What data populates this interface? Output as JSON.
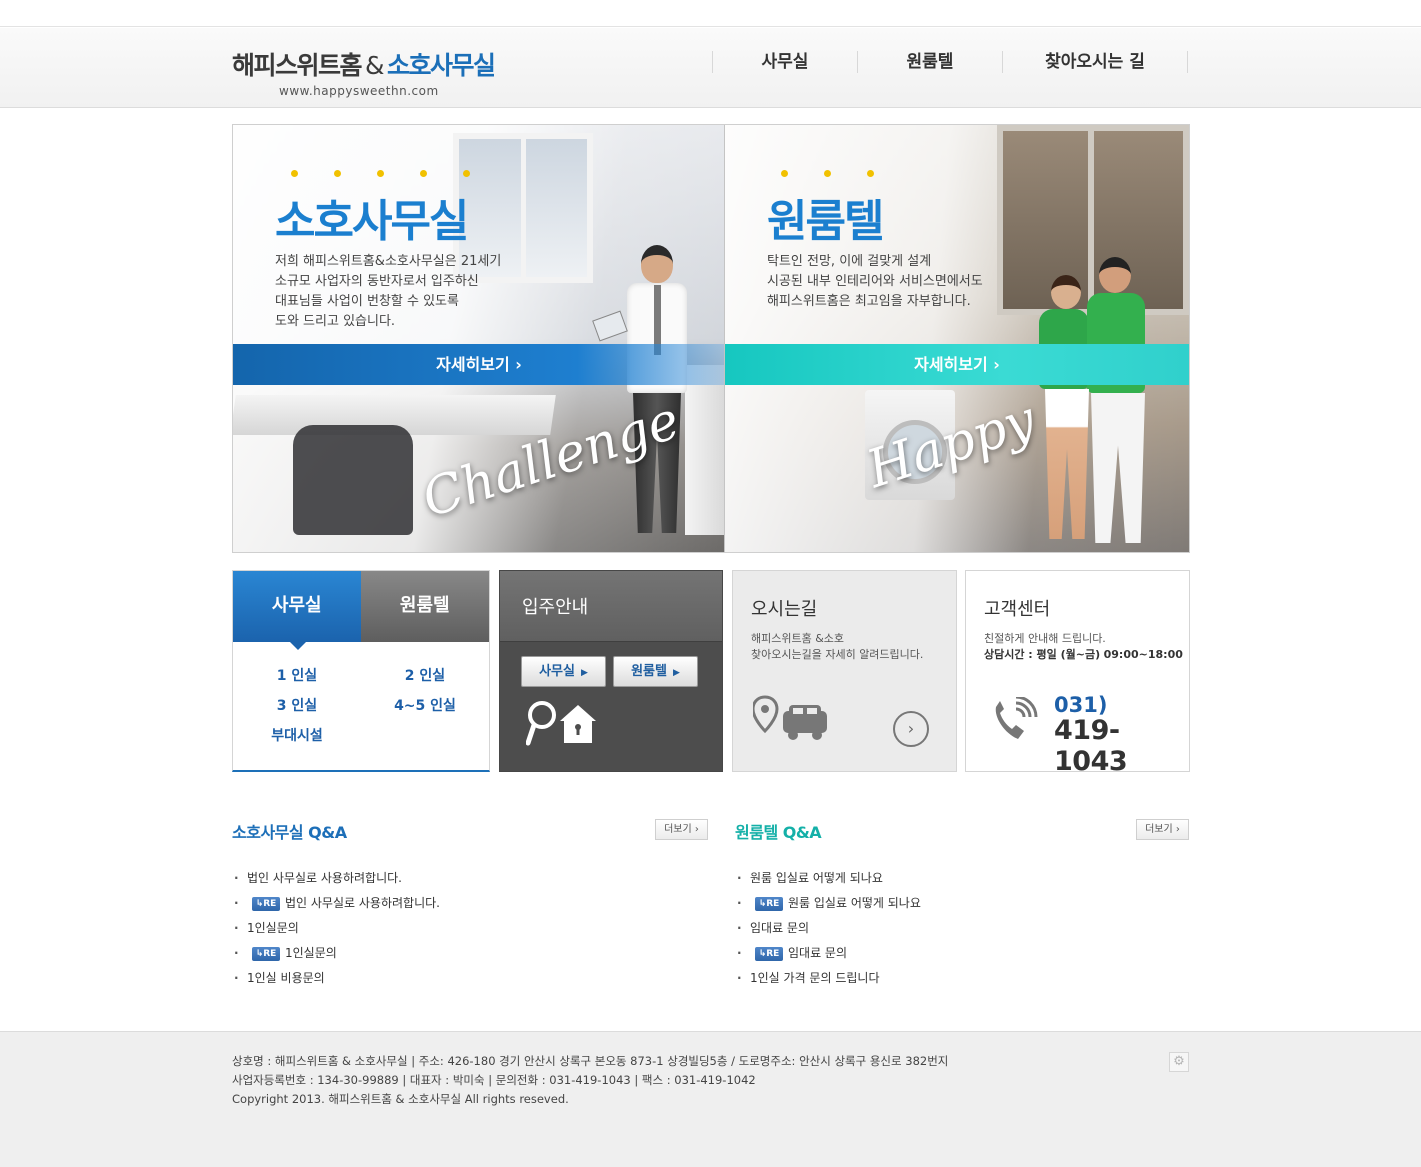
{
  "header": {
    "logo_main": "해피스위트홈",
    "logo_amp": "&",
    "logo_soho": "소호사무실",
    "logo_url": "www.happysweethn.com",
    "nav": [
      "사무실",
      "원룸텔",
      "찾아오시는 길"
    ]
  },
  "hero": {
    "left": {
      "title": "소호사무실",
      "desc": [
        "저희 해피스위트홈&소호사무실은 21세기",
        "소규모 사업자의 동반자로서 입주하신",
        "대표님들 사업이 번창할 수 있도록",
        "도와 드리고 있습니다."
      ],
      "button": "자세히보기",
      "script": "Challenge"
    },
    "right": {
      "title": "원룸텔",
      "desc": [
        "탁트인 전망, 이에 걸맞게 설계",
        "시공된 내부 인테리어와 서비스면에서도",
        "해피스위트홈은 최고임을 자부합니다."
      ],
      "button": "자세히보기",
      "script": "Happy"
    }
  },
  "rooms_widget": {
    "tabs": [
      "사무실",
      "원룸텔"
    ],
    "items": [
      "1 인실",
      "2 인실",
      "3 인실",
      "4~5 인실",
      "부대시설"
    ]
  },
  "move_in": {
    "title": "입주안내",
    "buttons": [
      "사무실",
      "원룸텔"
    ],
    "icon": "search-house-icon"
  },
  "directions": {
    "title": "오시는길",
    "sub": [
      "해피스위트홈 &소호",
      "찾아오시는길을 자세히 알려드립니다."
    ],
    "icon": "location-car-icon"
  },
  "customer_center": {
    "title": "고객센터",
    "sub": "친절하게 안내해 드립니다.",
    "hours_label": "상담시간 : 평일 (월~금)",
    "hours_value": "09:00~18:00",
    "phone_area": "031)",
    "phone_number": "419-1043"
  },
  "qna_office": {
    "title": "소호사무실 Q&A",
    "more": "더보기",
    "items": [
      {
        "reply": false,
        "text": "법인 사무실로 사용하려합니다."
      },
      {
        "reply": true,
        "text": "법인 사무실로 사용하려합니다."
      },
      {
        "reply": false,
        "text": "1인실문의"
      },
      {
        "reply": true,
        "text": "1인실문의"
      },
      {
        "reply": false,
        "text": "1인실 비용문의"
      }
    ]
  },
  "qna_room": {
    "title": "원룸텔 Q&A",
    "more": "더보기",
    "items": [
      {
        "reply": false,
        "text": "원룸 입실료 어떻게 되나요"
      },
      {
        "reply": true,
        "text": "원룸 입실료 어떻게 되나요"
      },
      {
        "reply": false,
        "text": "임대료 문의"
      },
      {
        "reply": true,
        "text": "임대료 문의"
      },
      {
        "reply": false,
        "text": "1인실 가격 문의 드립니다"
      }
    ]
  },
  "re_label": "RE",
  "footer": {
    "line1": "상호명 : 해피스위트홈 & 소호사무실    |    주소: 426-180 경기 안산시 상록구 본오동 873-1 상경빌딩5층    /    도로명주소: 안산시 상록구 용신로 382번지",
    "line2": "사업자등록번호 : 134-30-99889    |    대표자 : 박미숙    |    문의전화 : 031-419-1043    |    팩스 : 031-419-1042",
    "line3": "Copyright 2013. 해피스위트홈 & 소호사무실 All rights reseved."
  },
  "colors": {
    "brand_blue": "#1b6fb8",
    "teal": "#1ec9c2",
    "dot_yellow": "#f1c100"
  }
}
